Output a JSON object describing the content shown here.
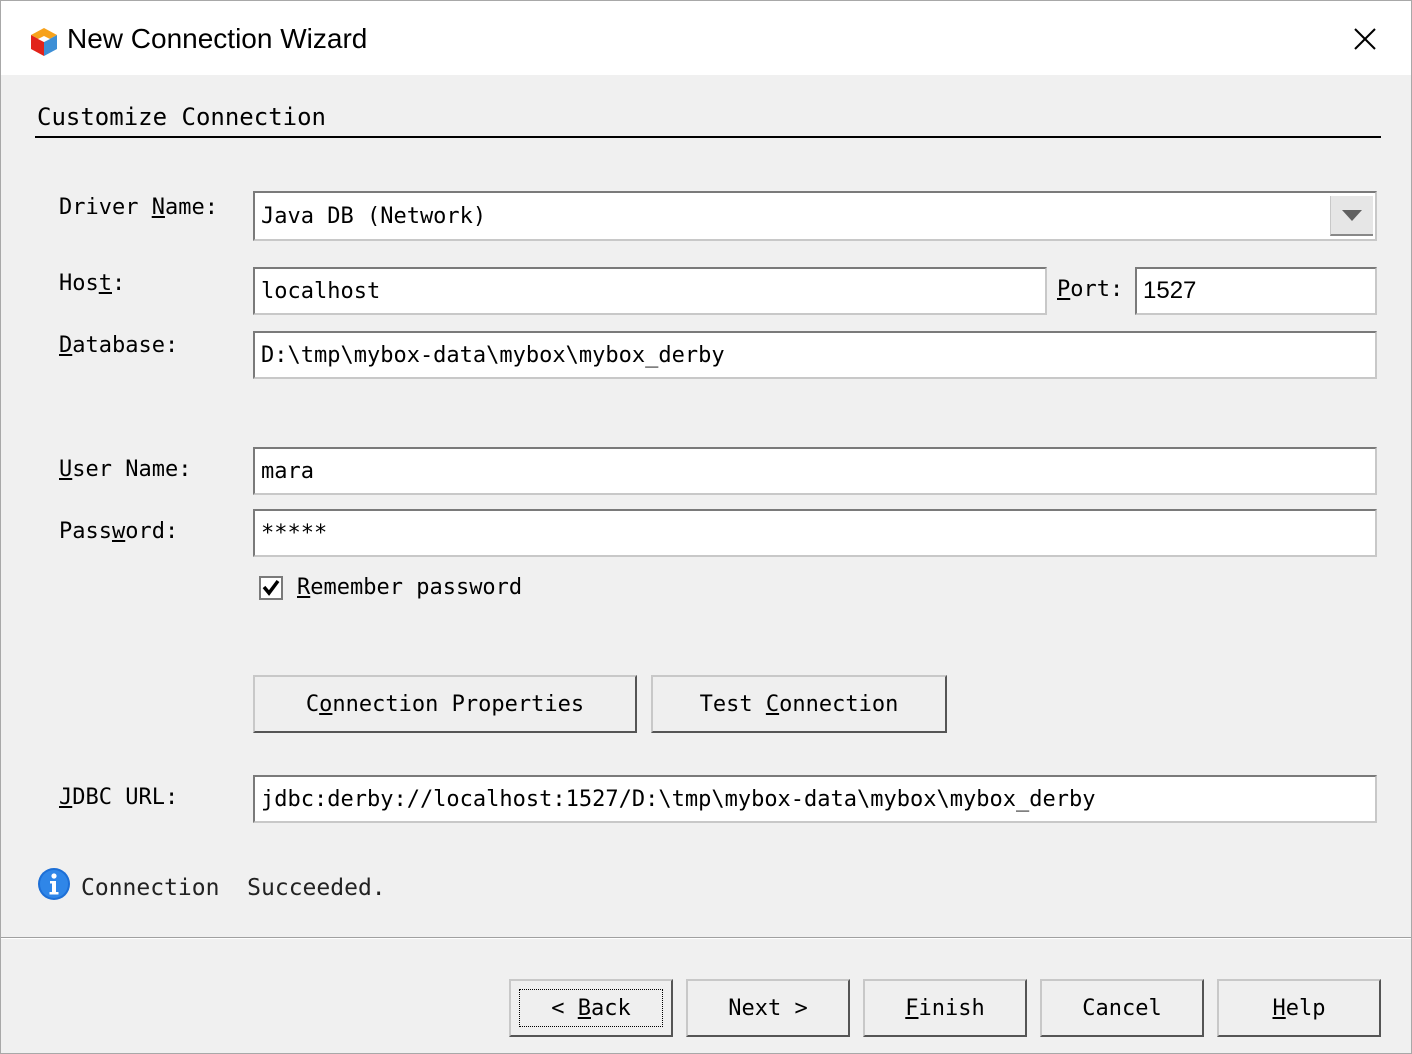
{
  "window": {
    "title": "New Connection Wizard",
    "app_icon": "netbeans-cube-icon",
    "close_icon": "close-icon"
  },
  "section": {
    "title": "Customize Connection"
  },
  "form": {
    "driver_label_pre": "Driver ",
    "driver_label_u": "N",
    "driver_label_post": "ame:",
    "driver_value": "Java DB (Network)",
    "host_label_pre": "Hos",
    "host_label_u": "t",
    "host_label_post": ":",
    "host_value": "localhost",
    "port_label_u": "P",
    "port_label_post": "ort:",
    "port_value": "1527",
    "database_label_u": "D",
    "database_label_post": "atabase:",
    "database_value": "D:\\tmp\\mybox-data\\mybox\\mybox_derby",
    "user_label_u": "U",
    "user_label_post": "ser Name:",
    "user_value": "mara",
    "password_label_pre": "Pass",
    "password_label_u": "w",
    "password_label_post": "ord:",
    "password_value": "*****",
    "remember_u": "R",
    "remember_post": "emember password",
    "remember_checked": true,
    "conn_props_pre": "C",
    "conn_props_u": "o",
    "conn_props_post": "nnection Properties",
    "test_conn_pre": "Test ",
    "test_conn_u": "C",
    "test_conn_post": "onnection",
    "jdbc_label_u": "J",
    "jdbc_label_post": "DBC URL:",
    "jdbc_value": "jdbc:derby://localhost:1527/D:\\tmp\\mybox-data\\mybox\\mybox_derby"
  },
  "status": {
    "icon": "info-icon",
    "text": "Connection  Succeeded."
  },
  "footer": {
    "back_pre": "< ",
    "back_u": "B",
    "back_post": "ack",
    "next_label": "Next >",
    "finish_u": "F",
    "finish_post": "inish",
    "cancel_label": "Cancel",
    "help_u": "H",
    "help_post": "elp"
  },
  "colors": {
    "info_blue": "#1d6fd6",
    "window_bg": "#f0f0f0"
  }
}
